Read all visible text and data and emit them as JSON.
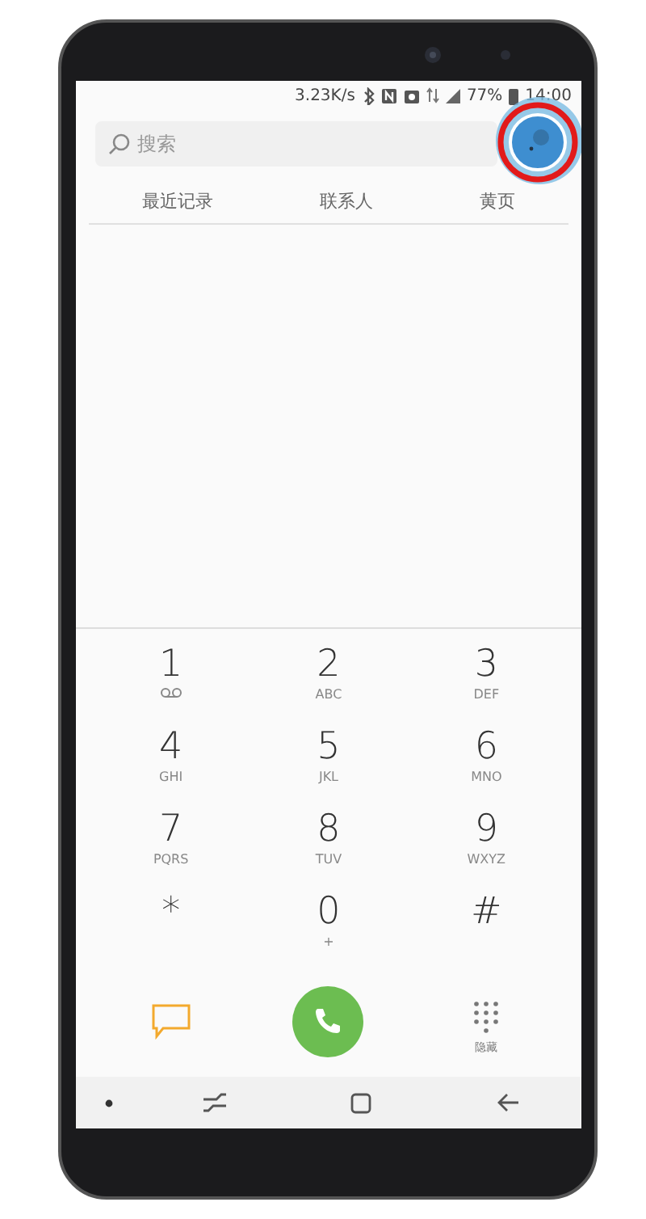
{
  "status_bar": {
    "network_speed": "3.23K/s",
    "battery": "77%",
    "time": "14:00"
  },
  "search": {
    "placeholder": "搜索"
  },
  "tabs": [
    {
      "label": "最近记录"
    },
    {
      "label": "联系人"
    },
    {
      "label": "黄页"
    }
  ],
  "keypad": [
    {
      "digit": "1",
      "kind": "voicemail"
    },
    {
      "digit": "2",
      "kind": "letters",
      "letters": "ABC"
    },
    {
      "digit": "3",
      "kind": "letters",
      "letters": "DEF"
    },
    {
      "digit": "4",
      "kind": "letters",
      "letters": "GHI"
    },
    {
      "digit": "5",
      "kind": "letters",
      "letters": "JKL"
    },
    {
      "digit": "6",
      "kind": "letters",
      "letters": "MNO"
    },
    {
      "digit": "7",
      "kind": "letters",
      "letters": "PQRS"
    },
    {
      "digit": "8",
      "kind": "letters",
      "letters": "TUV"
    },
    {
      "digit": "9",
      "kind": "letters",
      "letters": "WXYZ"
    },
    {
      "digit": "*",
      "kind": "plain"
    },
    {
      "digit": "0",
      "kind": "letters",
      "letters": "+"
    },
    {
      "digit": "#",
      "kind": "plain"
    }
  ],
  "hide_keypad": {
    "label": "隐藏"
  }
}
